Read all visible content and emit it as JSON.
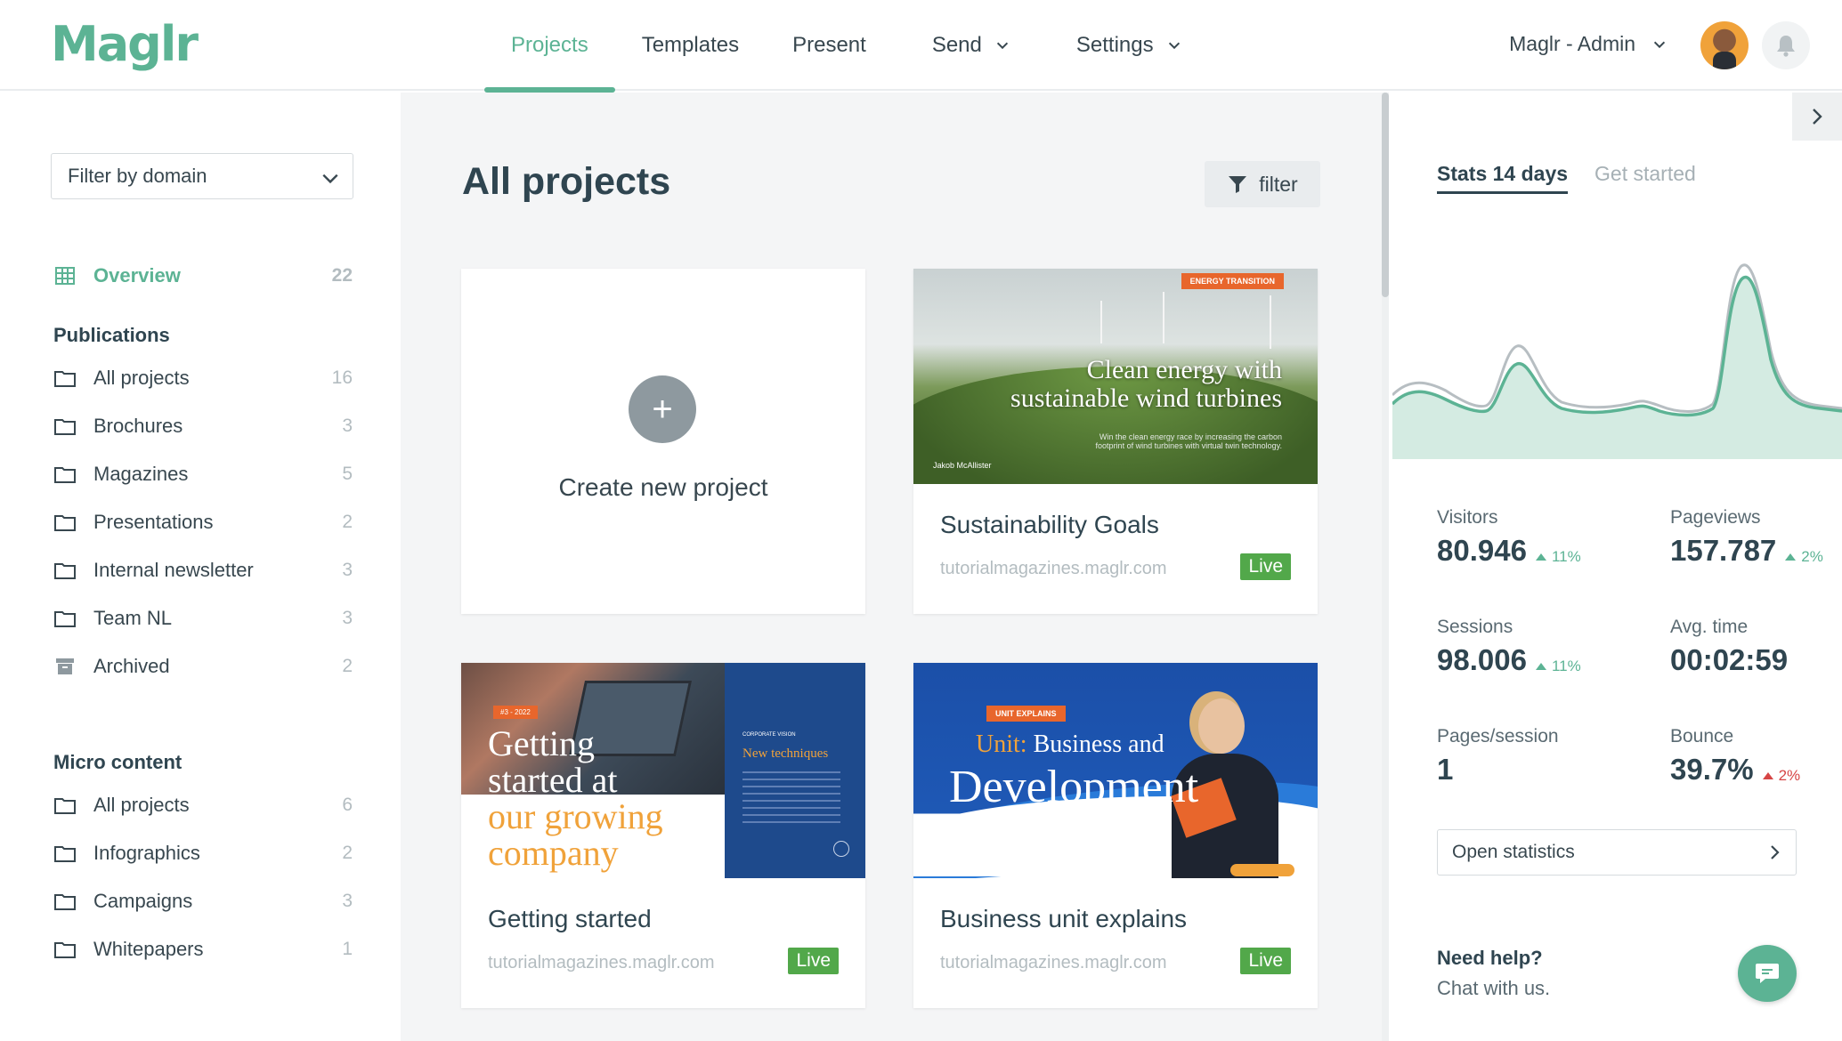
{
  "app": {
    "logo": "Maglr"
  },
  "nav": {
    "items": [
      {
        "label": "Projects",
        "active": true
      },
      {
        "label": "Templates"
      },
      {
        "label": "Present"
      },
      {
        "label": "Send",
        "dropdown": true
      },
      {
        "label": "Settings",
        "dropdown": true
      }
    ],
    "user_label": "Maglr - Admin"
  },
  "sidebar": {
    "domain_filter": "Filter by domain",
    "overview": {
      "label": "Overview",
      "count": "22"
    },
    "publications": {
      "heading": "Publications",
      "items": [
        {
          "label": "All projects",
          "count": "16"
        },
        {
          "label": "Brochures",
          "count": "3"
        },
        {
          "label": "Magazines",
          "count": "5"
        },
        {
          "label": "Presentations",
          "count": "2"
        },
        {
          "label": "Internal newsletter",
          "count": "3"
        },
        {
          "label": "Team NL",
          "count": "3"
        },
        {
          "label": "Archived",
          "count": "2"
        }
      ]
    },
    "micro": {
      "heading": "Micro content",
      "items": [
        {
          "label": "All projects",
          "count": "6"
        },
        {
          "label": "Infographics",
          "count": "2"
        },
        {
          "label": "Campaigns",
          "count": "3"
        },
        {
          "label": "Whitepapers",
          "count": "1"
        }
      ]
    }
  },
  "main": {
    "title": "All projects",
    "filter_label": "filter",
    "create_label": "Create new project",
    "cards": [
      {
        "title": "Sustainability Goals",
        "domain": "tutorialmagazines.maglr.com",
        "status": "Live",
        "thumb": {
          "tag": "ENERGY TRANSITION",
          "headline_1": "Clean energy with",
          "headline_2": "sustainable wind turbines",
          "sub": "Win the clean energy race by increasing the carbon footprint of wind turbines with virtual twin technology.",
          "author": "Jakob McAllister"
        }
      },
      {
        "title": "Getting started",
        "domain": "tutorialmagazines.maglr.com",
        "status": "Live",
        "thumb": {
          "tag": "#3 - 2022",
          "line_1": "Getting",
          "line_2": "started at",
          "line_3": "our growing",
          "line_4": "company",
          "panel_tag": "CORPORATE VISION",
          "panel_title": "New techniques"
        }
      },
      {
        "title": "Business unit explains",
        "domain": "tutorialmagazines.maglr.com",
        "status": "Live",
        "thumb": {
          "tag": "UNIT EXPLAINS",
          "line_1_accent": "Unit:",
          "line_1": " Business and",
          "line_2": "Development"
        }
      }
    ]
  },
  "stats": {
    "tabs": [
      {
        "label": "Stats 14 days",
        "active": true
      },
      {
        "label": "Get started"
      }
    ],
    "metrics": [
      {
        "label": "Visitors",
        "value": "80.946",
        "delta": "11%",
        "dir": "up"
      },
      {
        "label": "Pageviews",
        "value": "157.787",
        "delta": "2%",
        "dir": "up"
      },
      {
        "label": "Sessions",
        "value": "98.006",
        "delta": "11%",
        "dir": "up"
      },
      {
        "label": "Avg. time",
        "value": "00:02:59"
      },
      {
        "label": "Pages/session",
        "value": "1"
      },
      {
        "label": "Bounce",
        "value": "39.7%",
        "delta": "2%",
        "dir": "up-red"
      }
    ],
    "open_label": "Open statistics",
    "help_title": "Need help?",
    "help_sub": "Chat with us.",
    "colors": {
      "accent": "#5cb394",
      "negative": "#d64545"
    }
  }
}
